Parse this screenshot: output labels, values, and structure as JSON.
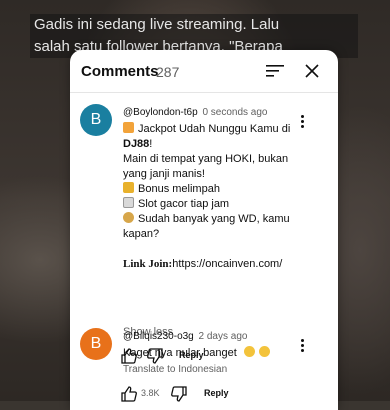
{
  "video": {
    "caption_line1": "Gadis ini sedang live streaming. Lalu",
    "caption_line2": "salah satu follower bertanya, \"Berapa"
  },
  "panel": {
    "title": "Comments",
    "count": "287"
  },
  "comments": [
    {
      "avatar_letter": "B",
      "avatar_color": "#1a7fa0",
      "username": "@Boylondon-t6p",
      "time": "0 seconds ago",
      "lines": [
        "Jackpot Udah Nunggu Kamu di",
        "DJ88",
        "!",
        "Main di tempat yang HOKI, bukan",
        "yang janji manis!",
        "Bonus melimpah",
        "Slot gacor tiap jam",
        "Sudah banyak yang WD, kamu",
        "kapan?",
        "Link Join:",
        "https://oncainven.com/"
      ],
      "show_less": "Show less",
      "likes": "",
      "reply_label": "Reply"
    },
    {
      "avatar_letter": "B",
      "avatar_color": "#e8711a",
      "username": "@Bilqis230-o3g",
      "time": "2 days ago",
      "text": "Kaget nya nular banget",
      "translate": "Translate to Indonesian",
      "likes": "3.8K",
      "reply_label": "Reply"
    }
  ]
}
